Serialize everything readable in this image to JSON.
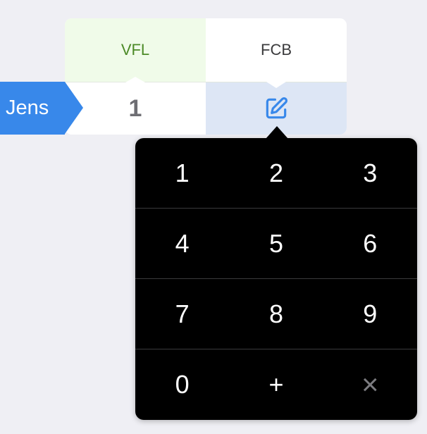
{
  "teams": {
    "home": "VFL",
    "away": "FCB"
  },
  "player": {
    "name": "Jens",
    "home_score": "1"
  },
  "icons": {
    "edit": "edit-icon",
    "clear": "close-icon"
  },
  "keypad": {
    "rows": [
      [
        "1",
        "2",
        "3"
      ],
      [
        "4",
        "5",
        "6"
      ],
      [
        "7",
        "8",
        "9"
      ],
      [
        "0",
        "+",
        "×"
      ]
    ]
  },
  "colors": {
    "accent": "#3888ea",
    "home_team": "#4c8a27",
    "home_header_bg": "#f0fbe9",
    "edit_cell_bg": "#dde6f5",
    "keypad_bg": "#000000"
  }
}
